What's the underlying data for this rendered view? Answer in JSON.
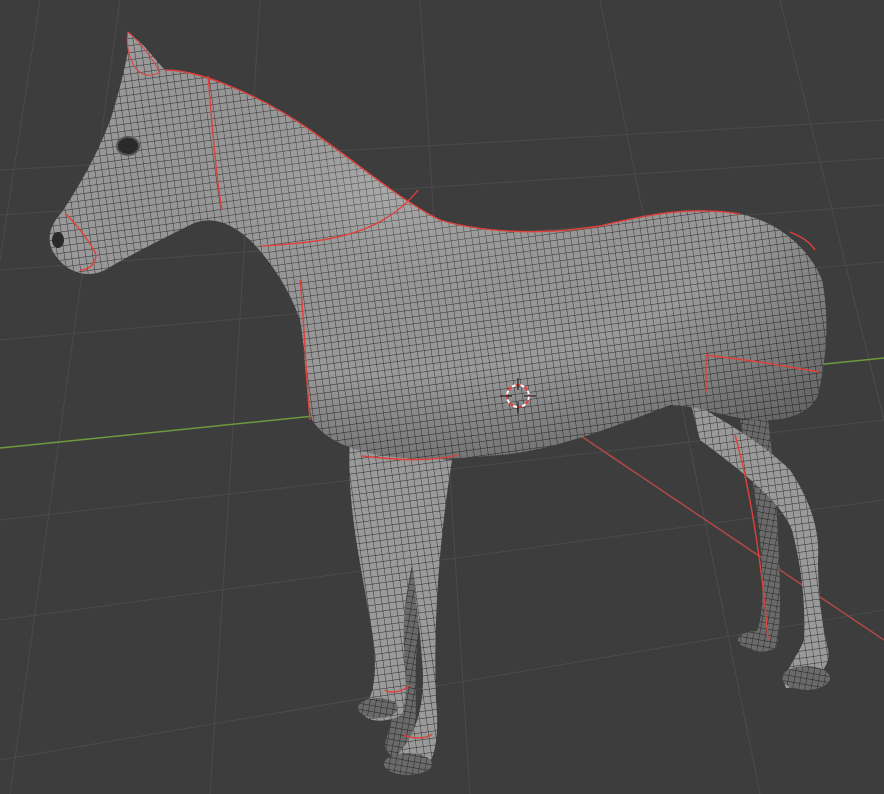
{
  "app": "3D viewport",
  "viewport": {
    "background_color": "#3d3d3d",
    "grid_color": "#4a4a4a",
    "x_axis_color": "#c94a4a",
    "y_axis_color": "#7fb04a",
    "seam_color": "#e0403a",
    "mesh_color": "#8a8a8a",
    "wire_color": "#2a2a2a",
    "object": "horse-mesh",
    "cursor": "3d-cursor-icon"
  }
}
